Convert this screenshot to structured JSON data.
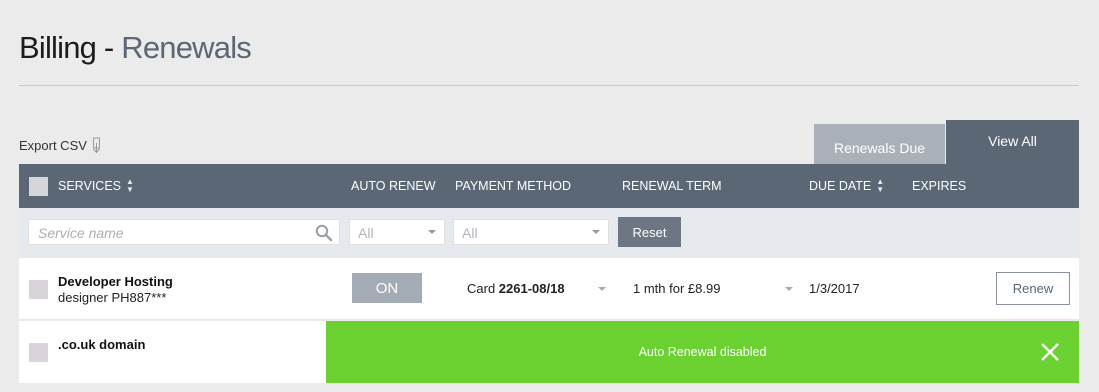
{
  "page": {
    "title_main": "Billing - ",
    "title_accent": "Renewals"
  },
  "toolbar": {
    "export_label": "Export CSV",
    "export_icon": "download-icon"
  },
  "tabs": [
    {
      "label": "Renewals Due",
      "active": false
    },
    {
      "label": "View All",
      "active": true
    }
  ],
  "table": {
    "columns": {
      "services": "SERVICES",
      "auto_renew": "AUTO RENEW",
      "payment_method": "PAYMENT METHOD",
      "renewal_term": "RENEWAL TERM",
      "due_date": "DUE DATE",
      "expires": "EXPIRES"
    },
    "filters": {
      "search_placeholder": "Service name",
      "auto_renew_value": "All",
      "payment_method_value": "All",
      "reset_label": "Reset"
    },
    "rows": [
      {
        "name": "Developer Hosting",
        "subtitle": "designer PH887***",
        "auto_renew": "ON",
        "payment_prefix": "Card ",
        "payment_card": "2261-08/18",
        "term": "1 mth for £8.99",
        "due": "1/3/2017",
        "action": "Renew"
      },
      {
        "name": ".co.uk domain"
      }
    ]
  },
  "toast": {
    "message": "Auto Renewal disabled",
    "color": "#6ad131"
  },
  "colors": {
    "header": "#5b6775",
    "background": "#ebebeb"
  }
}
